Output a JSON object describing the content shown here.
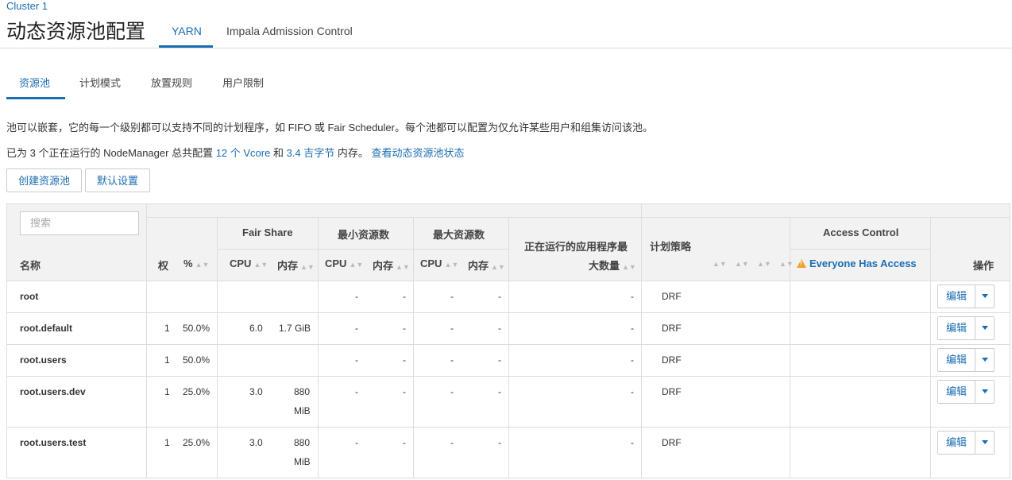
{
  "header": {
    "cluster_link": "Cluster 1",
    "title": "动态资源池配置",
    "tabs": [
      {
        "label": "YARN",
        "active": true
      },
      {
        "label": "Impala Admission Control",
        "active": false
      }
    ]
  },
  "subtabs": [
    {
      "label": "资源池",
      "active": true
    },
    {
      "label": "计划模式",
      "active": false
    },
    {
      "label": "放置规则",
      "active": false
    },
    {
      "label": "用户限制",
      "active": false
    }
  ],
  "description": {
    "line1": "池可以嵌套，它的每一个级别都可以支持不同的计划程序，如 FIFO 或 Fair Scheduler。每个池都可以配置为仅允许某些用户和组集访问该池。",
    "line2_prefix": "已为 3 个正在运行的 NodeManager 总共配置 ",
    "vcore_link": "12 个 Vcore",
    "line2_and": " 和 ",
    "memory_link": "3.4 吉字节",
    "line2_suffix": " 内存。 ",
    "status_link": "查看动态资源池状态"
  },
  "buttons": {
    "create_pool": "创建资源池",
    "default_settings": "默认设置"
  },
  "table": {
    "search_placeholder": "搜索",
    "headers": {
      "name": "名称",
      "weight": "权",
      "percent": "%",
      "fair_share": "Fair Share",
      "cpu": "CPU",
      "memory": "内存",
      "min_resources": "最小资源数",
      "max_resources": "最大资源数",
      "max_running_apps_line1": "正在运行的应用程序最",
      "max_running_apps_line2": "大数量",
      "scheduling_policy": "计划策略",
      "access_control": "Access Control",
      "everyone_access": "Everyone Has Access",
      "actions": "操作"
    },
    "rows": [
      {
        "name": "root",
        "weight": "",
        "percent": "",
        "fs_cpu": "",
        "fs_mem": "",
        "min_cpu": "-",
        "min_mem": "-",
        "max_cpu": "-",
        "max_mem": "-",
        "max_apps": "-",
        "policy": "DRF",
        "edit": "编辑"
      },
      {
        "name": "root.default",
        "weight": "1",
        "percent": "50.0%",
        "fs_cpu": "6.0",
        "fs_mem": "1.7 GiB",
        "min_cpu": "-",
        "min_mem": "-",
        "max_cpu": "-",
        "max_mem": "-",
        "max_apps": "-",
        "policy": "DRF",
        "edit": "编辑"
      },
      {
        "name": "root.users",
        "weight": "1",
        "percent": "50.0%",
        "fs_cpu": "",
        "fs_mem": "",
        "min_cpu": "-",
        "min_mem": "-",
        "max_cpu": "-",
        "max_mem": "-",
        "max_apps": "-",
        "policy": "DRF",
        "edit": "编辑"
      },
      {
        "name": "root.users.dev",
        "weight": "1",
        "percent": "25.0%",
        "fs_cpu": "3.0",
        "fs_mem_1": "880",
        "fs_mem_2": "MiB",
        "min_cpu": "-",
        "min_mem": "-",
        "max_cpu": "-",
        "max_mem": "-",
        "max_apps": "-",
        "policy": "DRF",
        "edit": "编辑"
      },
      {
        "name": "root.users.test",
        "weight": "1",
        "percent": "25.0%",
        "fs_cpu": "3.0",
        "fs_mem_1": "880",
        "fs_mem_2": "MiB",
        "min_cpu": "-",
        "min_mem": "-",
        "max_cpu": "-",
        "max_mem": "-",
        "max_apps": "-",
        "policy": "DRF",
        "edit": "编辑"
      }
    ]
  },
  "colors": {
    "accent": "#1a6db3",
    "warning": "#f0a030",
    "header_bg": "#f2f2f2"
  }
}
